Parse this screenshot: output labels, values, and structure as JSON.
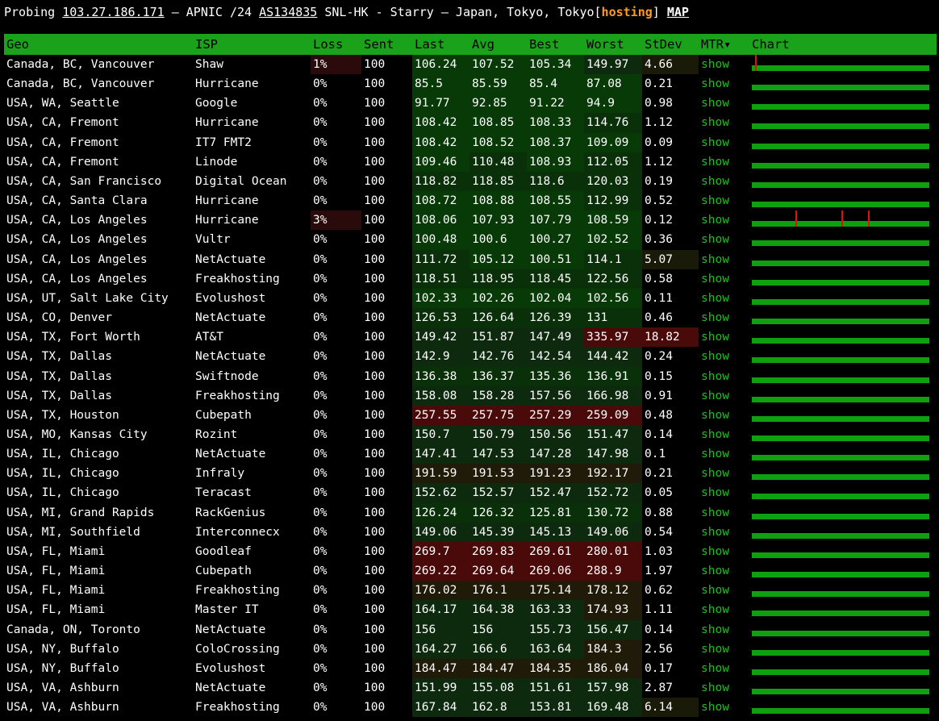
{
  "header": {
    "prefix": "Probing",
    "ip": "103.27.186.171",
    "mid": "– APNIC /24",
    "asn": "AS134835",
    "rest": "SNL-HK - Starry – Japan, Tokyo, Tokyo",
    "bracket_open": "[",
    "hosting": "hosting",
    "bracket_close": "]",
    "map": "MAP"
  },
  "columns": {
    "geo": "Geo",
    "isp": "ISP",
    "loss": "Loss",
    "sent": "Sent",
    "last": "Last",
    "avg": "Avg",
    "best": "Best",
    "worst": "Worst",
    "stdev": "StDev",
    "mtr": "MTR▾",
    "chart": "Chart"
  },
  "colors": {
    "header_bg": "#1ba21b",
    "link": "#1fbf1f",
    "hosting": "#ff9a1f",
    "chart_bar": "#0fa00f",
    "spike": "#e01010"
  },
  "rows": [
    {
      "geo": "Canada, BC, Vancouver",
      "isp": "Shaw",
      "loss": "1%",
      "sent": "100",
      "last": "106.24",
      "avg": "107.52",
      "best": "105.34",
      "worst": "149.97",
      "stdev": "4.66",
      "mtr": "show",
      "spikes": [
        4
      ]
    },
    {
      "geo": "Canada, BC, Vancouver",
      "isp": "Hurricane",
      "loss": "0%",
      "sent": "100",
      "last": "85.5",
      "avg": "85.59",
      "best": "85.4",
      "worst": "87.08",
      "stdev": "0.21",
      "mtr": "show",
      "spikes": []
    },
    {
      "geo": "USA, WA, Seattle",
      "isp": "Google",
      "loss": "0%",
      "sent": "100",
      "last": "91.77",
      "avg": "92.85",
      "best": "91.22",
      "worst": "94.9",
      "stdev": "0.98",
      "mtr": "show",
      "spikes": []
    },
    {
      "geo": "USA, CA, Fremont",
      "isp": "Hurricane",
      "loss": "0%",
      "sent": "100",
      "last": "108.42",
      "avg": "108.85",
      "best": "108.33",
      "worst": "114.76",
      "stdev": "1.12",
      "mtr": "show",
      "spikes": []
    },
    {
      "geo": "USA, CA, Fremont",
      "isp": "IT7 FMT2",
      "loss": "0%",
      "sent": "100",
      "last": "108.42",
      "avg": "108.52",
      "best": "108.37",
      "worst": "109.09",
      "stdev": "0.09",
      "mtr": "show",
      "spikes": []
    },
    {
      "geo": "USA, CA, Fremont",
      "isp": "Linode",
      "loss": "0%",
      "sent": "100",
      "last": "109.46",
      "avg": "110.48",
      "best": "108.93",
      "worst": "112.05",
      "stdev": "1.12",
      "mtr": "show",
      "spikes": []
    },
    {
      "geo": "USA, CA, San Francisco",
      "isp": "Digital Ocean",
      "loss": "0%",
      "sent": "100",
      "last": "118.82",
      "avg": "118.85",
      "best": "118.6",
      "worst": "120.03",
      "stdev": "0.19",
      "mtr": "show",
      "spikes": []
    },
    {
      "geo": "USA, CA, Santa Clara",
      "isp": "Hurricane",
      "loss": "0%",
      "sent": "100",
      "last": "108.72",
      "avg": "108.88",
      "best": "108.55",
      "worst": "112.99",
      "stdev": "0.52",
      "mtr": "show",
      "spikes": []
    },
    {
      "geo": "USA, CA, Los Angeles",
      "isp": "Hurricane",
      "loss": "3%",
      "sent": "100",
      "last": "108.06",
      "avg": "107.93",
      "best": "107.79",
      "worst": "108.59",
      "stdev": "0.12",
      "mtr": "show",
      "spikes": [
        54,
        111,
        144
      ]
    },
    {
      "geo": "USA, CA, Los Angeles",
      "isp": "Vultr",
      "loss": "0%",
      "sent": "100",
      "last": "100.48",
      "avg": "100.6",
      "best": "100.27",
      "worst": "102.52",
      "stdev": "0.36",
      "mtr": "show",
      "spikes": []
    },
    {
      "geo": "USA, CA, Los Angeles",
      "isp": "NetActuate",
      "loss": "0%",
      "sent": "100",
      "last": "111.72",
      "avg": "105.12",
      "best": "100.51",
      "worst": "114.1",
      "stdev": "5.07",
      "mtr": "show",
      "spikes": []
    },
    {
      "geo": "USA, CA, Los Angeles",
      "isp": "Freakhosting",
      "loss": "0%",
      "sent": "100",
      "last": "118.51",
      "avg": "118.95",
      "best": "118.45",
      "worst": "122.56",
      "stdev": "0.58",
      "mtr": "show",
      "spikes": []
    },
    {
      "geo": "USA, UT, Salt Lake City",
      "isp": "Evolushost",
      "loss": "0%",
      "sent": "100",
      "last": "102.33",
      "avg": "102.26",
      "best": "102.04",
      "worst": "102.56",
      "stdev": "0.11",
      "mtr": "show",
      "spikes": []
    },
    {
      "geo": "USA, CO, Denver",
      "isp": "NetActuate",
      "loss": "0%",
      "sent": "100",
      "last": "126.53",
      "avg": "126.64",
      "best": "126.39",
      "worst": "131",
      "stdev": "0.46",
      "mtr": "show",
      "spikes": []
    },
    {
      "geo": "USA, TX, Fort Worth",
      "isp": "AT&T",
      "loss": "0%",
      "sent": "100",
      "last": "149.42",
      "avg": "151.87",
      "best": "147.49",
      "worst": "335.97",
      "stdev": "18.82",
      "mtr": "show",
      "spikes": []
    },
    {
      "geo": "USA, TX, Dallas",
      "isp": "NetActuate",
      "loss": "0%",
      "sent": "100",
      "last": "142.9",
      "avg": "142.76",
      "best": "142.54",
      "worst": "144.42",
      "stdev": "0.24",
      "mtr": "show",
      "spikes": []
    },
    {
      "geo": "USA, TX, Dallas",
      "isp": "Swiftnode",
      "loss": "0%",
      "sent": "100",
      "last": "136.38",
      "avg": "136.37",
      "best": "135.36",
      "worst": "136.91",
      "stdev": "0.15",
      "mtr": "show",
      "spikes": []
    },
    {
      "geo": "USA, TX, Dallas",
      "isp": "Freakhosting",
      "loss": "0%",
      "sent": "100",
      "last": "158.08",
      "avg": "158.28",
      "best": "157.56",
      "worst": "166.98",
      "stdev": "0.91",
      "mtr": "show",
      "spikes": []
    },
    {
      "geo": "USA, TX, Houston",
      "isp": "Cubepath",
      "loss": "0%",
      "sent": "100",
      "last": "257.55",
      "avg": "257.75",
      "best": "257.29",
      "worst": "259.09",
      "stdev": "0.48",
      "mtr": "show",
      "spikes": []
    },
    {
      "geo": "USA, MO, Kansas City",
      "isp": "Rozint",
      "loss": "0%",
      "sent": "100",
      "last": "150.7",
      "avg": "150.79",
      "best": "150.56",
      "worst": "151.47",
      "stdev": "0.14",
      "mtr": "show",
      "spikes": []
    },
    {
      "geo": "USA, IL, Chicago",
      "isp": "NetActuate",
      "loss": "0%",
      "sent": "100",
      "last": "147.41",
      "avg": "147.53",
      "best": "147.28",
      "worst": "147.98",
      "stdev": "0.1",
      "mtr": "show",
      "spikes": []
    },
    {
      "geo": "USA, IL, Chicago",
      "isp": "Infraly",
      "loss": "0%",
      "sent": "100",
      "last": "191.59",
      "avg": "191.53",
      "best": "191.23",
      "worst": "192.17",
      "stdev": "0.21",
      "mtr": "show",
      "spikes": []
    },
    {
      "geo": "USA, IL, Chicago",
      "isp": "Teracast",
      "loss": "0%",
      "sent": "100",
      "last": "152.62",
      "avg": "152.57",
      "best": "152.47",
      "worst": "152.72",
      "stdev": "0.05",
      "mtr": "show",
      "spikes": []
    },
    {
      "geo": "USA, MI, Grand Rapids",
      "isp": "RackGenius",
      "loss": "0%",
      "sent": "100",
      "last": "126.24",
      "avg": "126.32",
      "best": "125.81",
      "worst": "130.72",
      "stdev": "0.88",
      "mtr": "show",
      "spikes": []
    },
    {
      "geo": "USA, MI, Southfield",
      "isp": "Interconnecx",
      "loss": "0%",
      "sent": "100",
      "last": "149.06",
      "avg": "145.39",
      "best": "145.13",
      "worst": "149.06",
      "stdev": "0.54",
      "mtr": "show",
      "spikes": []
    },
    {
      "geo": "USA, FL, Miami",
      "isp": "Goodleaf",
      "loss": "0%",
      "sent": "100",
      "last": "269.7",
      "avg": "269.83",
      "best": "269.61",
      "worst": "280.01",
      "stdev": "1.03",
      "mtr": "show",
      "spikes": []
    },
    {
      "geo": "USA, FL, Miami",
      "isp": "Cubepath",
      "loss": "0%",
      "sent": "100",
      "last": "269.22",
      "avg": "269.64",
      "best": "269.06",
      "worst": "288.9",
      "stdev": "1.97",
      "mtr": "show",
      "spikes": []
    },
    {
      "geo": "USA, FL, Miami",
      "isp": "Freakhosting",
      "loss": "0%",
      "sent": "100",
      "last": "176.02",
      "avg": "176.1",
      "best": "175.14",
      "worst": "178.12",
      "stdev": "0.62",
      "mtr": "show",
      "spikes": []
    },
    {
      "geo": "USA, FL, Miami",
      "isp": "Master IT",
      "loss": "0%",
      "sent": "100",
      "last": "164.17",
      "avg": "164.38",
      "best": "163.33",
      "worst": "174.93",
      "stdev": "1.11",
      "mtr": "show",
      "spikes": []
    },
    {
      "geo": "Canada, ON, Toronto",
      "isp": "NetActuate",
      "loss": "0%",
      "sent": "100",
      "last": "156",
      "avg": "156",
      "best": "155.73",
      "worst": "156.47",
      "stdev": "0.14",
      "mtr": "show",
      "spikes": []
    },
    {
      "geo": "USA, NY, Buffalo",
      "isp": "ColoCrossing",
      "loss": "0%",
      "sent": "100",
      "last": "164.27",
      "avg": "166.6",
      "best": "163.64",
      "worst": "184.3",
      "stdev": "2.56",
      "mtr": "show",
      "spikes": []
    },
    {
      "geo": "USA, NY, Buffalo",
      "isp": "Evolushost",
      "loss": "0%",
      "sent": "100",
      "last": "184.47",
      "avg": "184.47",
      "best": "184.35",
      "worst": "186.04",
      "stdev": "0.17",
      "mtr": "show",
      "spikes": []
    },
    {
      "geo": "USA, VA, Ashburn",
      "isp": "NetActuate",
      "loss": "0%",
      "sent": "100",
      "last": "151.99",
      "avg": "155.08",
      "best": "151.61",
      "worst": "157.98",
      "stdev": "2.87",
      "mtr": "show",
      "spikes": []
    },
    {
      "geo": "USA, VA, Ashburn",
      "isp": "Freakhosting",
      "loss": "0%",
      "sent": "100",
      "last": "167.84",
      "avg": "162.8",
      "best": "153.81",
      "worst": "169.48",
      "stdev": "6.14",
      "mtr": "show",
      "spikes": []
    }
  ]
}
